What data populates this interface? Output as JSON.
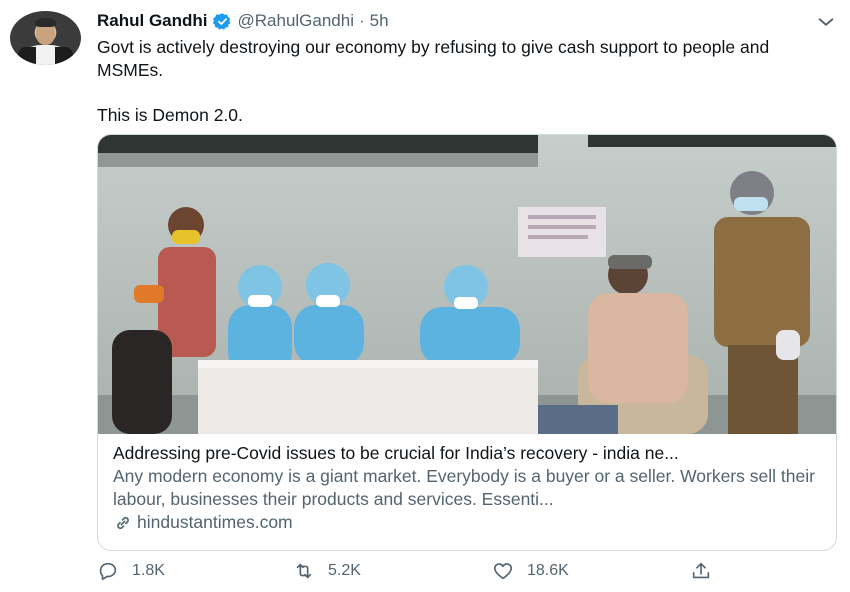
{
  "tweet": {
    "author_name": "Rahul Gandhi",
    "handle": "@RahulGandhi",
    "separator": "·",
    "time": "5h",
    "text_paragraph_1": "Govt is actively destroying our economy by refusing to give cash support to people and MSMEs.",
    "text_paragraph_2": "This is Demon 2.0."
  },
  "card": {
    "title": "Addressing pre-Covid issues to be crucial for India’s recovery - india ne...",
    "description": "Any modern economy is a giant market. Everybody is a buyer or a seller. Workers sell their labour, businesses their products and services. Essenti...",
    "domain": "hindustantimes.com"
  },
  "actions": {
    "replies": "1.8K",
    "retweets": "5.2K",
    "likes": "18.6K"
  },
  "icons": [
    "verified-badge-icon",
    "chevron-down-icon",
    "reply-icon",
    "retweet-icon",
    "like-icon",
    "share-icon",
    "link-icon"
  ],
  "colors": {
    "verified_blue": "#1d9bf0",
    "secondary_text": "#536471",
    "primary_text": "#0f1419",
    "card_border": "#cfd9de"
  }
}
